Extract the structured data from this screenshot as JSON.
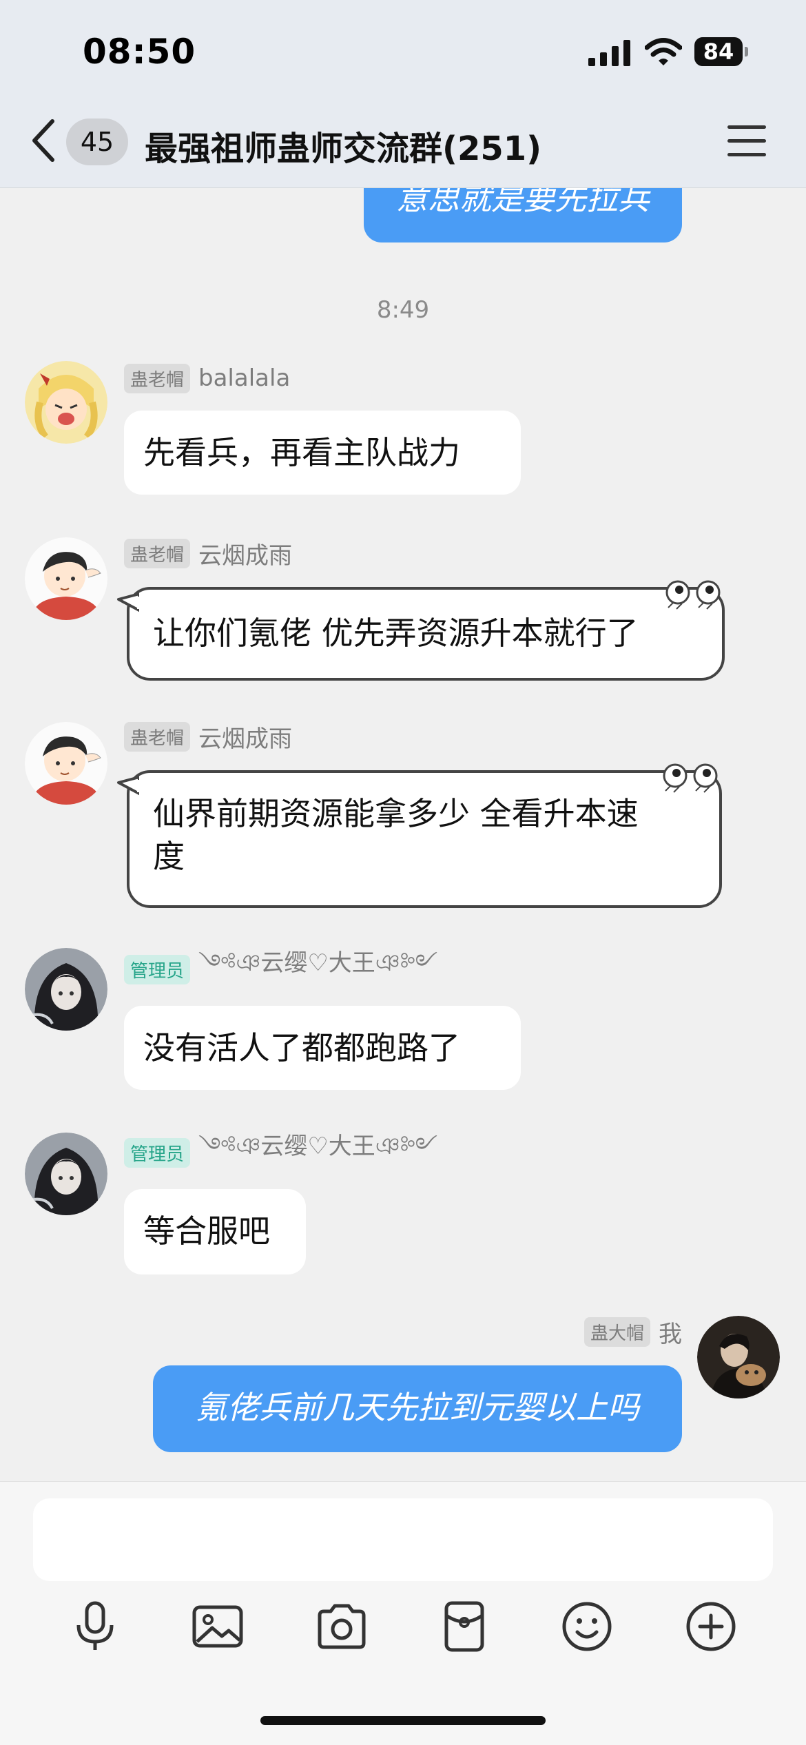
{
  "status_bar": {
    "time": "08:50",
    "battery": "84"
  },
  "header": {
    "unread_count": "45",
    "title": "最强祖师蛊师交流群(251)"
  },
  "top_partial_message": "意思就是要先拉兵",
  "timestamp": "8:49",
  "messages": [
    {
      "tag": "蛊老帽",
      "name": "balalala",
      "text": "先看兵，再看主队战力"
    },
    {
      "tag": "蛊老帽",
      "name": "云烟成雨",
      "text": "让你们氪佬 优先弄资源升本就行了"
    },
    {
      "tag": "蛊老帽",
      "name": "云烟成雨",
      "text_line1": "仙界前期资源能拿多少 全看升本速",
      "text_line2": "度"
    },
    {
      "tag": "管理员",
      "name": "༺ঞ云缨♡大王ঞ༻",
      "text": "没有活人了都都跑路了"
    },
    {
      "tag": "管理员",
      "name": "༺ঞ云缨♡大王ঞ༻",
      "text": "等合服吧"
    },
    {
      "tag": "蛊大帽",
      "name": "我",
      "text": "氪佬兵前几天先拉到元婴以上吗"
    }
  ],
  "colors": {
    "self_bubble": "#4a9cf5",
    "admin_tag": "#27a58a"
  },
  "icons": [
    "microphone-icon",
    "image-icon",
    "camera-icon",
    "red-packet-icon",
    "emoji-icon",
    "plus-icon"
  ]
}
